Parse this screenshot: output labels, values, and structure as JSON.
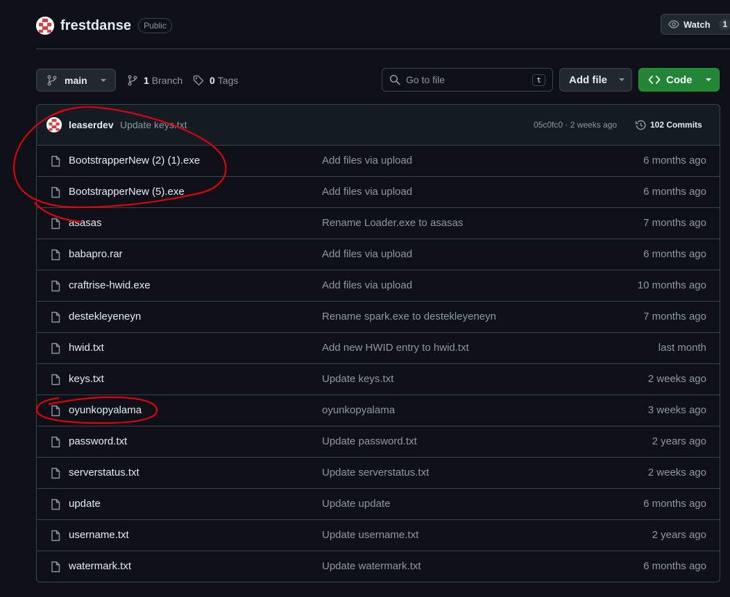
{
  "repo": {
    "name": "frestdanse",
    "visibility": "Public"
  },
  "watch": {
    "label": "Watch",
    "count": "1"
  },
  "toolbar": {
    "branch": "main",
    "branches_count": "1",
    "branches_label": "Branch",
    "tags_count": "0",
    "tags_label": "Tags",
    "search_placeholder": "Go to file",
    "search_shortcut": "t",
    "add_file_label": "Add file",
    "code_label": "Code"
  },
  "latest_commit": {
    "author": "leaserdev",
    "message": "Update keys.txt",
    "hash_time": "05c0fc0 · 2 weeks ago",
    "commits_label": "102 Commits"
  },
  "files": [
    {
      "name": "BootstrapperNew (2) (1).exe",
      "message": "Add files via upload",
      "time": "6 months ago"
    },
    {
      "name": "BootstrapperNew (5).exe",
      "message": "Add files via upload",
      "time": "6 months ago"
    },
    {
      "name": "asasas",
      "message": "Rename Loader.exe to asasas",
      "time": "7 months ago"
    },
    {
      "name": "babapro.rar",
      "message": "Add files via upload",
      "time": "6 months ago"
    },
    {
      "name": "craftrise-hwid.exe",
      "message": "Add files via upload",
      "time": "10 months ago"
    },
    {
      "name": "destekleyeneyn",
      "message": "Rename spark.exe to destekleyeneyn",
      "time": "7 months ago"
    },
    {
      "name": "hwid.txt",
      "message": "Add new HWID entry to hwid.txt",
      "time": "last month"
    },
    {
      "name": "keys.txt",
      "message": "Update keys.txt",
      "time": "2 weeks ago"
    },
    {
      "name": "oyunkopyalama",
      "message": "oyunkopyalama",
      "time": "3 weeks ago"
    },
    {
      "name": "password.txt",
      "message": "Update password.txt",
      "time": "2 years ago"
    },
    {
      "name": "serverstatus.txt",
      "message": "Update serverstatus.txt",
      "time": "2 weeks ago"
    },
    {
      "name": "update",
      "message": "Update update",
      "time": "6 months ago"
    },
    {
      "name": "username.txt",
      "message": "Update username.txt",
      "time": "2 years ago"
    },
    {
      "name": "watermark.txt",
      "message": "Update watermark.txt",
      "time": "6 months ago"
    }
  ],
  "icons": {
    "avatar": "red-white-identicon-avatar",
    "watch": "eye-icon",
    "branch": "git-branch-icon",
    "tag": "tag-icon",
    "search": "search-icon",
    "code": "code-icon",
    "history": "history-icon",
    "file": "file-icon"
  },
  "colors": {
    "background": "#0d1117",
    "code_button": "#238636",
    "annotation": "#e0000f"
  }
}
